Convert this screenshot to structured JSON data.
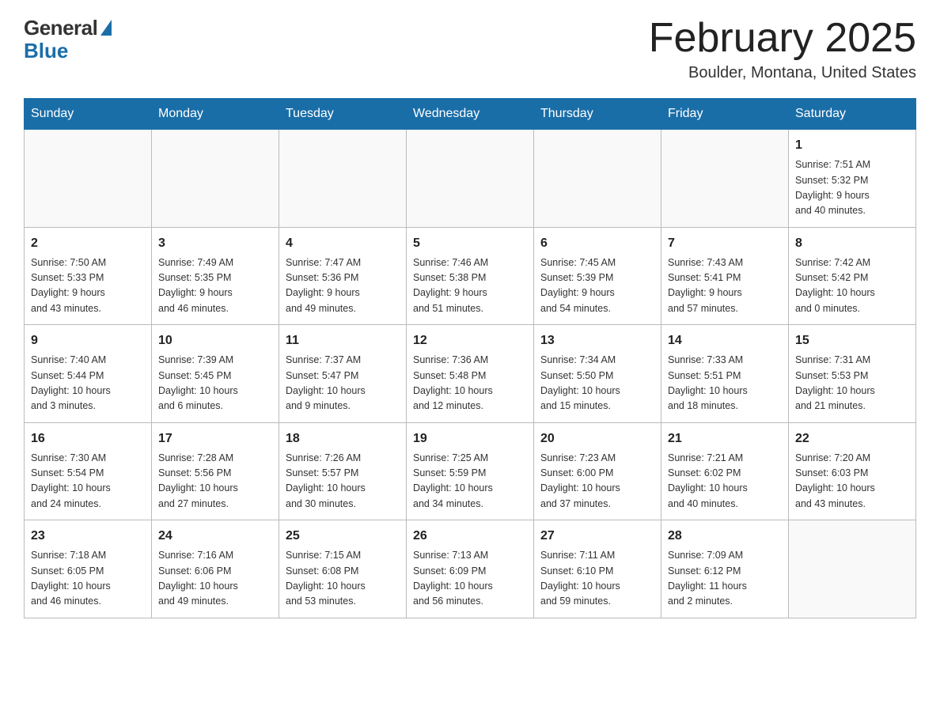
{
  "header": {
    "logo_general": "General",
    "logo_blue": "Blue",
    "title": "February 2025",
    "location": "Boulder, Montana, United States"
  },
  "days_of_week": [
    "Sunday",
    "Monday",
    "Tuesday",
    "Wednesday",
    "Thursday",
    "Friday",
    "Saturday"
  ],
  "weeks": [
    [
      {
        "day": "",
        "info": ""
      },
      {
        "day": "",
        "info": ""
      },
      {
        "day": "",
        "info": ""
      },
      {
        "day": "",
        "info": ""
      },
      {
        "day": "",
        "info": ""
      },
      {
        "day": "",
        "info": ""
      },
      {
        "day": "1",
        "info": "Sunrise: 7:51 AM\nSunset: 5:32 PM\nDaylight: 9 hours\nand 40 minutes."
      }
    ],
    [
      {
        "day": "2",
        "info": "Sunrise: 7:50 AM\nSunset: 5:33 PM\nDaylight: 9 hours\nand 43 minutes."
      },
      {
        "day": "3",
        "info": "Sunrise: 7:49 AM\nSunset: 5:35 PM\nDaylight: 9 hours\nand 46 minutes."
      },
      {
        "day": "4",
        "info": "Sunrise: 7:47 AM\nSunset: 5:36 PM\nDaylight: 9 hours\nand 49 minutes."
      },
      {
        "day": "5",
        "info": "Sunrise: 7:46 AM\nSunset: 5:38 PM\nDaylight: 9 hours\nand 51 minutes."
      },
      {
        "day": "6",
        "info": "Sunrise: 7:45 AM\nSunset: 5:39 PM\nDaylight: 9 hours\nand 54 minutes."
      },
      {
        "day": "7",
        "info": "Sunrise: 7:43 AM\nSunset: 5:41 PM\nDaylight: 9 hours\nand 57 minutes."
      },
      {
        "day": "8",
        "info": "Sunrise: 7:42 AM\nSunset: 5:42 PM\nDaylight: 10 hours\nand 0 minutes."
      }
    ],
    [
      {
        "day": "9",
        "info": "Sunrise: 7:40 AM\nSunset: 5:44 PM\nDaylight: 10 hours\nand 3 minutes."
      },
      {
        "day": "10",
        "info": "Sunrise: 7:39 AM\nSunset: 5:45 PM\nDaylight: 10 hours\nand 6 minutes."
      },
      {
        "day": "11",
        "info": "Sunrise: 7:37 AM\nSunset: 5:47 PM\nDaylight: 10 hours\nand 9 minutes."
      },
      {
        "day": "12",
        "info": "Sunrise: 7:36 AM\nSunset: 5:48 PM\nDaylight: 10 hours\nand 12 minutes."
      },
      {
        "day": "13",
        "info": "Sunrise: 7:34 AM\nSunset: 5:50 PM\nDaylight: 10 hours\nand 15 minutes."
      },
      {
        "day": "14",
        "info": "Sunrise: 7:33 AM\nSunset: 5:51 PM\nDaylight: 10 hours\nand 18 minutes."
      },
      {
        "day": "15",
        "info": "Sunrise: 7:31 AM\nSunset: 5:53 PM\nDaylight: 10 hours\nand 21 minutes."
      }
    ],
    [
      {
        "day": "16",
        "info": "Sunrise: 7:30 AM\nSunset: 5:54 PM\nDaylight: 10 hours\nand 24 minutes."
      },
      {
        "day": "17",
        "info": "Sunrise: 7:28 AM\nSunset: 5:56 PM\nDaylight: 10 hours\nand 27 minutes."
      },
      {
        "day": "18",
        "info": "Sunrise: 7:26 AM\nSunset: 5:57 PM\nDaylight: 10 hours\nand 30 minutes."
      },
      {
        "day": "19",
        "info": "Sunrise: 7:25 AM\nSunset: 5:59 PM\nDaylight: 10 hours\nand 34 minutes."
      },
      {
        "day": "20",
        "info": "Sunrise: 7:23 AM\nSunset: 6:00 PM\nDaylight: 10 hours\nand 37 minutes."
      },
      {
        "day": "21",
        "info": "Sunrise: 7:21 AM\nSunset: 6:02 PM\nDaylight: 10 hours\nand 40 minutes."
      },
      {
        "day": "22",
        "info": "Sunrise: 7:20 AM\nSunset: 6:03 PM\nDaylight: 10 hours\nand 43 minutes."
      }
    ],
    [
      {
        "day": "23",
        "info": "Sunrise: 7:18 AM\nSunset: 6:05 PM\nDaylight: 10 hours\nand 46 minutes."
      },
      {
        "day": "24",
        "info": "Sunrise: 7:16 AM\nSunset: 6:06 PM\nDaylight: 10 hours\nand 49 minutes."
      },
      {
        "day": "25",
        "info": "Sunrise: 7:15 AM\nSunset: 6:08 PM\nDaylight: 10 hours\nand 53 minutes."
      },
      {
        "day": "26",
        "info": "Sunrise: 7:13 AM\nSunset: 6:09 PM\nDaylight: 10 hours\nand 56 minutes."
      },
      {
        "day": "27",
        "info": "Sunrise: 7:11 AM\nSunset: 6:10 PM\nDaylight: 10 hours\nand 59 minutes."
      },
      {
        "day": "28",
        "info": "Sunrise: 7:09 AM\nSunset: 6:12 PM\nDaylight: 11 hours\nand 2 minutes."
      },
      {
        "day": "",
        "info": ""
      }
    ]
  ]
}
